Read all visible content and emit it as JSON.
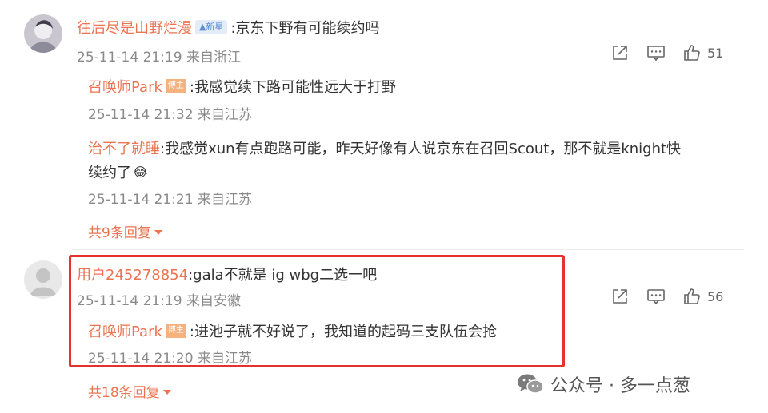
{
  "comments": [
    {
      "user": "往后尽是山野烂漫",
      "badge": "▲新星",
      "text": ":京东下野有可能续约吗",
      "time": "25-11-14 21:19 来自浙江",
      "likes": "51",
      "replies": [
        {
          "user": "召唤师Park",
          "badge": "博主",
          "text": ":我感觉续下路可能性远大于打野",
          "time": "25-11-14 21:32 来自江苏"
        },
        {
          "user": "治不了就睡",
          "text_line1": ":我感觉xun有点跑路可能，昨天好像有人说京东在召回Scout，那不就是knight快",
          "text_line2": "续约了",
          "emoji": "😂",
          "time": "25-11-14 21:21 来自江苏"
        }
      ],
      "more_replies": "共9条回复"
    },
    {
      "user": "用户245278854",
      "text": ":gala不就是 ig wbg二选一吧",
      "time": "25-11-14 21:19 来自安徽",
      "likes": "56",
      "replies": [
        {
          "user": "召唤师Park",
          "badge": "博主",
          "text": ":进池子就不好说了，我知道的起码三支队伍会抢",
          "time": "25-11-14 21:20 来自江苏"
        }
      ],
      "more_replies": "共18条回复"
    }
  ],
  "watermark": {
    "text": "公众号 · 多一点葱"
  },
  "colors": {
    "username": "#eb7350",
    "highlight_border": "#e63131",
    "meta": "#8a8a8a"
  }
}
